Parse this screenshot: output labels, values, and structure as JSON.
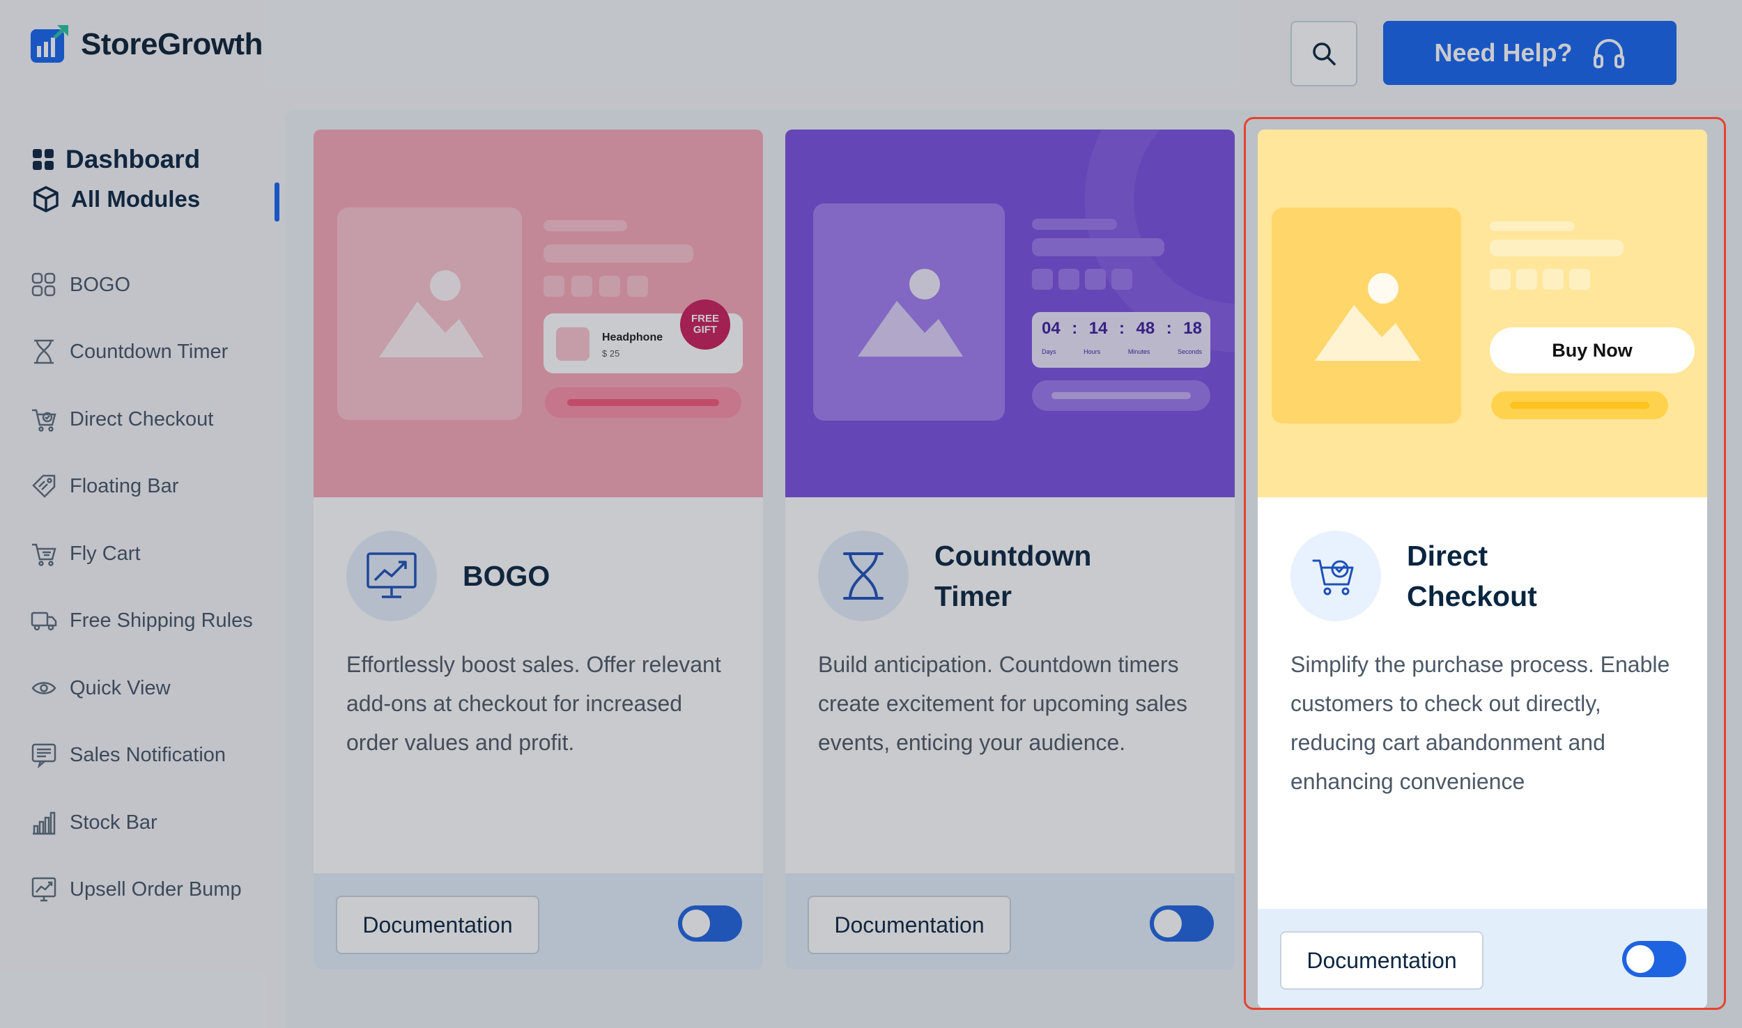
{
  "brand": {
    "name": "StoreGrowth"
  },
  "header": {
    "help_label": "Need Help?"
  },
  "sidebar": {
    "dashboard_label": "Dashboard",
    "all_modules_label": "All Modules",
    "items": [
      {
        "label": "BOGO",
        "icon": "bogo-icon"
      },
      {
        "label": "Countdown Timer",
        "icon": "hourglass-icon"
      },
      {
        "label": "Direct Checkout",
        "icon": "cart-check-icon"
      },
      {
        "label": "Floating Bar",
        "icon": "tag-icon"
      },
      {
        "label": "Fly Cart",
        "icon": "cart-icon"
      },
      {
        "label": "Free Shipping Rules",
        "icon": "truck-icon"
      },
      {
        "label": "Quick View",
        "icon": "eye-icon"
      },
      {
        "label": "Sales Notification",
        "icon": "notification-icon"
      },
      {
        "label": "Stock Bar",
        "icon": "bar-chart-icon"
      },
      {
        "label": "Upsell Order Bump",
        "icon": "trend-chart-icon"
      }
    ]
  },
  "cards": [
    {
      "title": "BOGO",
      "description": "Effortlessly boost sales. Offer relevant add-ons at checkout for increased order values and profit.",
      "doc_label": "Documentation",
      "hero": {
        "product_name": "Headphone",
        "product_price": "$ 25",
        "badge": "FREE GIFT"
      },
      "color": "#f7a7b7"
    },
    {
      "title": "Countdown Timer",
      "description": "Build anticipation. Countdown timers create excitement for upcoming sales events, enticing your audience.",
      "doc_label": "Documentation",
      "hero": {
        "timer": [
          "04",
          "14",
          "48",
          "18"
        ],
        "timer_units": [
          "Days",
          "Hours",
          "Minutes",
          "Seconds"
        ]
      },
      "color": "#7a4fe0"
    },
    {
      "title": "Direct Checkout",
      "description": "Simplify the purchase process. Enable customers to check out directly, reducing cart abandonment and enhancing convenience",
      "doc_label": "Documentation",
      "hero": {
        "buy_label": "Buy Now"
      },
      "color": "#ffe69a",
      "highlighted": true
    }
  ]
}
